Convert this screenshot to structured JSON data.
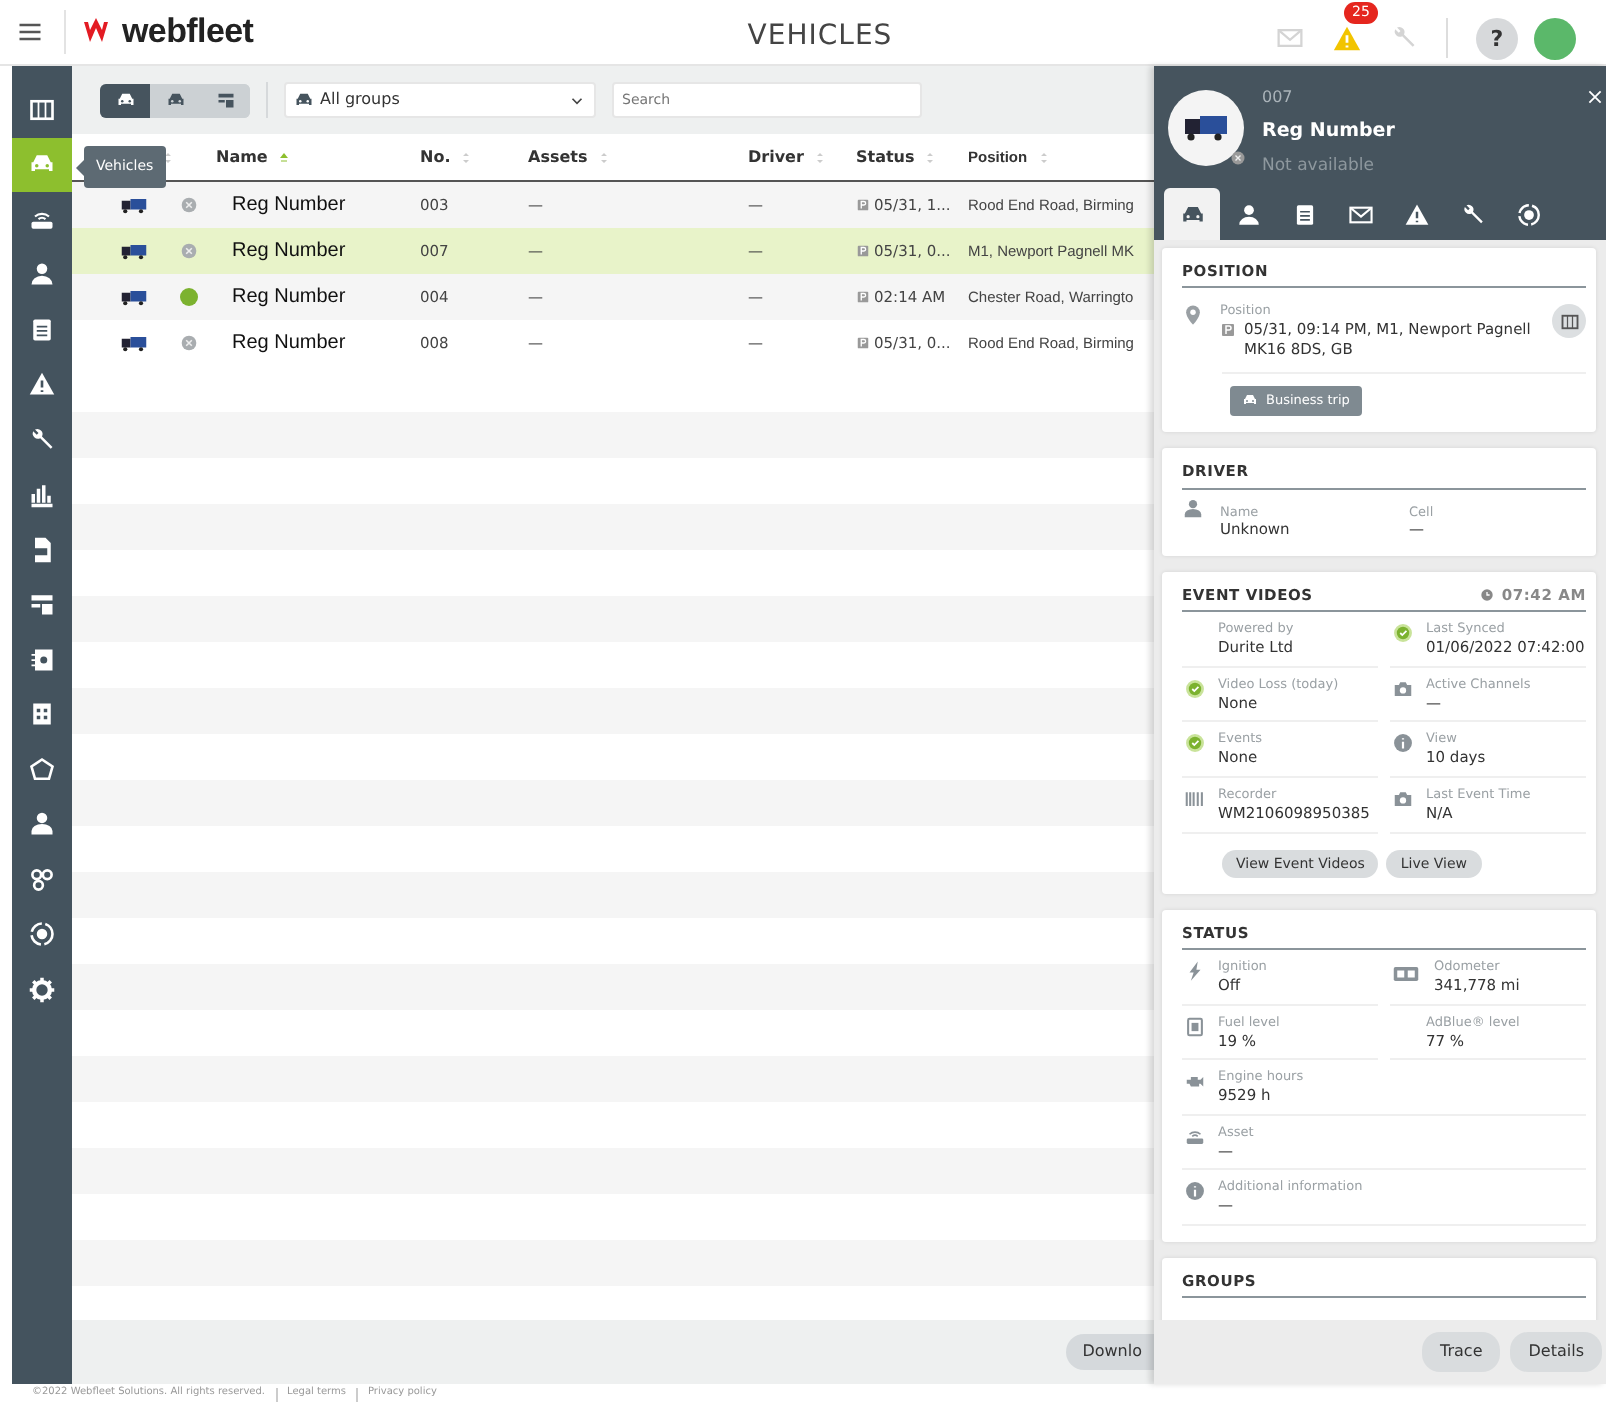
{
  "header": {
    "logo_text": "webfleet",
    "title": "VEHICLES",
    "alerts_badge": "25",
    "help_label": "?"
  },
  "sidebar": {
    "items": [
      {
        "selected": false
      },
      {
        "selected": true
      },
      {
        "selected": false
      },
      {
        "selected": false
      },
      {
        "selected": false
      },
      {
        "selected": false
      },
      {
        "selected": false
      },
      {
        "selected": false
      },
      {
        "selected": false
      },
      {
        "selected": false
      },
      {
        "selected": false
      },
      {
        "selected": false
      },
      {
        "selected": false
      },
      {
        "selected": false
      },
      {
        "selected": false
      },
      {
        "selected": false
      },
      {
        "selected": false
      }
    ],
    "tooltip": "Vehicles"
  },
  "toolbar": {
    "view_toggles": [
      {
        "selected": true
      },
      {
        "selected": false
      },
      {
        "selected": false
      }
    ],
    "group_select": "All groups",
    "search": {
      "placeholder": "Search"
    }
  },
  "table": {
    "columns": [
      {
        "label": "Name",
        "sorted": true
      },
      {
        "label": "No.",
        "sorted": false
      },
      {
        "label": "Assets",
        "sorted": false
      },
      {
        "label": "Driver",
        "sorted": false
      },
      {
        "label": "Status",
        "sorted": false
      },
      {
        "label": "Position",
        "sorted": false
      }
    ],
    "rows": [
      {
        "online": false,
        "selected": false,
        "name": "Reg Number",
        "no": "003",
        "assets": "—",
        "driver": "—",
        "status": "05/31, 1...",
        "position": "Rood End Road, Birming"
      },
      {
        "online": false,
        "selected": true,
        "name": "Reg Number",
        "no": "007",
        "assets": "—",
        "driver": "—",
        "status": "05/31, 0...",
        "position": "M1, Newport Pagnell MK"
      },
      {
        "online": true,
        "selected": false,
        "name": "Reg Number",
        "no": "004",
        "assets": "—",
        "driver": "—",
        "status": "02:14 AM",
        "position": "Chester Road, Warringto"
      },
      {
        "online": false,
        "selected": false,
        "name": "Reg Number",
        "no": "008",
        "assets": "—",
        "driver": "—",
        "status": "05/31, 0...",
        "position": "Rood End Road, Birming"
      }
    ]
  },
  "download_button": "Downlo",
  "panel": {
    "number": "007",
    "name": "Reg Number",
    "availability": "Not available",
    "tabs": [
      {
        "selected": true
      },
      {
        "selected": false
      },
      {
        "selected": false
      },
      {
        "selected": false
      },
      {
        "selected": false
      },
      {
        "selected": false
      },
      {
        "selected": false
      }
    ],
    "position": {
      "title": "POSITION",
      "label": "Position",
      "value": "05/31, 09:14 PM, M1, Newport Pagnell MK16 8DS, GB",
      "trip_button": "Business trip"
    },
    "driver": {
      "title": "DRIVER",
      "fields": [
        {
          "label": "Name",
          "value": "Unknown"
        },
        {
          "label": "Cell",
          "value": "—"
        }
      ]
    },
    "event_videos": {
      "title": "EVENT VIDEOS",
      "time": "07:42 AM",
      "fields": [
        {
          "kind": "none",
          "label": "Powered by",
          "value": "Durite Ltd"
        },
        {
          "kind": "check",
          "label": "Last Synced",
          "value": "01/06/2022 07:42:00"
        },
        {
          "kind": "check",
          "label": "Video Loss (today)",
          "value": "None"
        },
        {
          "kind": "camera",
          "label": "Active Channels",
          "value": "—"
        },
        {
          "kind": "check",
          "label": "Events",
          "value": "None"
        },
        {
          "kind": "info",
          "label": "View",
          "value": "10 days"
        },
        {
          "kind": "barcode",
          "label": "Recorder",
          "value": "WM2106098950385"
        },
        {
          "kind": "camera",
          "label": "Last Event Time",
          "value": "N/A"
        }
      ],
      "buttons": [
        "View Event Videos",
        "Live View"
      ]
    },
    "status": {
      "title": "STATUS",
      "fields": [
        {
          "kind": "bolt",
          "label": "Ignition",
          "value": "Off",
          "wide": false
        },
        {
          "kind": "odometer",
          "label": "Odometer",
          "value": "341,778 mi",
          "wide": false
        },
        {
          "kind": "fuel",
          "label": "Fuel level",
          "value": "19 %",
          "wide": false
        },
        {
          "kind": "none",
          "label": "AdBlue® level",
          "value": "77 %",
          "wide": false
        },
        {
          "kind": "engine",
          "label": "Engine hours",
          "value": "9529 h",
          "wide": true
        },
        {
          "kind": "asset",
          "label": "Asset",
          "value": "—",
          "wide": true
        },
        {
          "kind": "info",
          "label": "Additional information",
          "value": "—",
          "wide": true
        }
      ]
    },
    "groups": {
      "title": "GROUPS"
    },
    "buttons": [
      "Trace",
      "Details"
    ]
  },
  "footer": {
    "copyright": "©2022 Webfleet Solutions. All rights reserved.",
    "links": [
      "Legal terms",
      "Privacy policy"
    ]
  }
}
